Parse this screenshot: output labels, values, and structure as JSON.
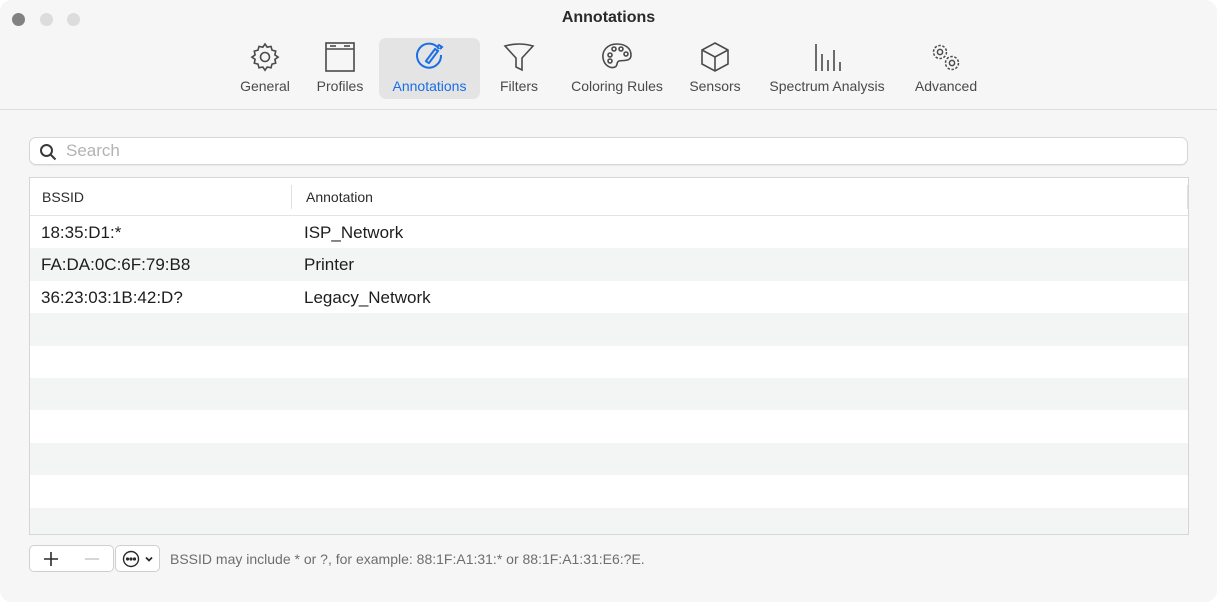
{
  "window": {
    "title": "Annotations"
  },
  "toolbar": {
    "items": [
      {
        "label": "General",
        "icon": "gear-icon",
        "active": false
      },
      {
        "label": "Profiles",
        "icon": "window-icon",
        "active": false
      },
      {
        "label": "Annotations",
        "icon": "pencil-circle-icon",
        "active": true
      },
      {
        "label": "Filters",
        "icon": "funnel-icon",
        "active": false
      },
      {
        "label": "Coloring Rules",
        "icon": "palette-icon",
        "active": false
      },
      {
        "label": "Sensors",
        "icon": "cube-icon",
        "active": false
      },
      {
        "label": "Spectrum Analysis",
        "icon": "bars-icon",
        "active": false
      },
      {
        "label": "Advanced",
        "icon": "gears-icon",
        "active": false
      }
    ],
    "accent_color": "#1a6ee6"
  },
  "search": {
    "placeholder": "Search",
    "value": ""
  },
  "table": {
    "columns": [
      "BSSID",
      "Annotation"
    ],
    "rows": [
      {
        "bssid": "18:35:D1:*",
        "annotation": "ISP_Network"
      },
      {
        "bssid": "FA:DA:0C:6F:79:B8",
        "annotation": "Printer"
      },
      {
        "bssid": "36:23:03:1B:42:D?",
        "annotation": "Legacy_Network"
      }
    ]
  },
  "footer": {
    "add_label": "+",
    "remove_label": "—",
    "hint": "BSSID may include * or ?, for example: 88:1F:A1:31:* or 88:1F:A1:31:E6:?E."
  }
}
